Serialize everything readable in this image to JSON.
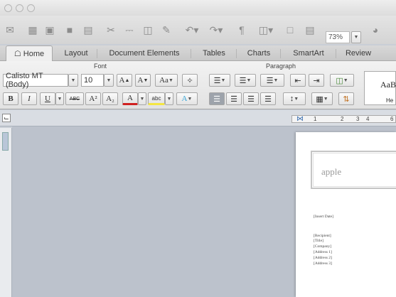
{
  "toolbar": {
    "icons": [
      "new-document-icon",
      "templates-icon",
      "open-icon",
      "save-icon",
      "print-icon",
      "cut-icon",
      "copy-icon",
      "paste-icon",
      "format-painter-icon",
      "undo-icon",
      "redo-icon",
      "paragraph-marks-icon",
      "sidebar-icon",
      "media-icon",
      "zoom-icon"
    ],
    "zoom_value": "73%"
  },
  "tabs": [
    {
      "label": "Home",
      "active": true
    },
    {
      "label": "Layout"
    },
    {
      "label": "Document Elements"
    },
    {
      "label": "Tables"
    },
    {
      "label": "Charts"
    },
    {
      "label": "SmartArt"
    },
    {
      "label": "Review"
    }
  ],
  "ribbon": {
    "font_group_label": "Font",
    "paragraph_group_label": "Paragraph",
    "font_name": "Calisto MT (Body)",
    "font_size": "10",
    "bold": "B",
    "italic": "I",
    "underline": "U",
    "strikethrough": "ABC",
    "superscript": "A²",
    "subscript": "A₂",
    "font_color": "A",
    "highlight": "abc",
    "grow_font": "A",
    "shrink_font": "A",
    "change_case": "Aa",
    "text_effects": "A",
    "style_preview": "AaB",
    "style_label": "He"
  },
  "ruler": {
    "marks": [
      "1",
      "2",
      "3",
      "4",
      "6"
    ]
  },
  "document": {
    "title_text": "apple",
    "lines": [
      "[Insert Date]",
      "[Recipient]",
      "[Title]",
      "[Company]",
      "[Address 1]",
      "[Address 2]",
      "[Address 3]"
    ]
  },
  "colors": {
    "accent_red": "#d02020",
    "highlight_yellow": "#f4e642",
    "canvas": "#bcc2cc"
  }
}
